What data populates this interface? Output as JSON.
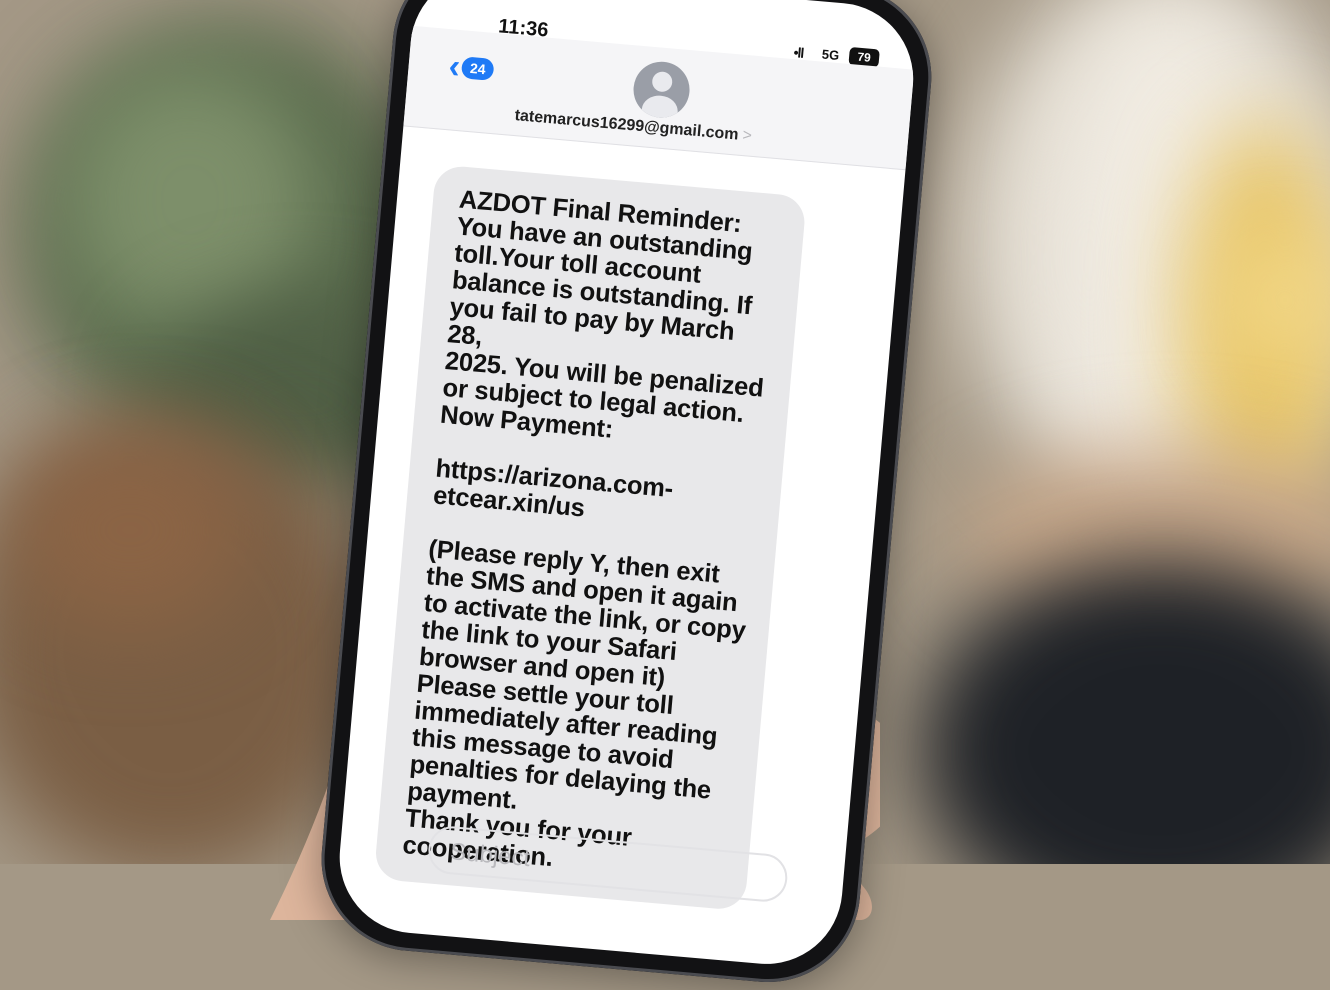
{
  "status_bar": {
    "time": "11:36",
    "signal": "•ll",
    "network": "5G",
    "battery": "79"
  },
  "header": {
    "back_badge": "24",
    "contact": "tatemarcus16299@gmail.com",
    "contact_arrow": ">"
  },
  "message": {
    "lines": [
      "AZDOT Final Reminder:",
      "You have an outstanding",
      "toll.Your toll account",
      "balance is outstanding. If",
      "you fail to pay by March 28,",
      "2025. You will be penalized",
      "or subject to legal action.",
      "Now Payment:",
      "",
      "https://arizona.com-",
      "etcear.xin/us",
      "",
      "(Please reply Y, then exit",
      "the SMS and open it again",
      "to activate the link, or copy",
      "the link to your Safari",
      "browser and open it)",
      "Please settle your toll",
      "immediately after reading",
      "this message to avoid",
      "penalties for delaying the",
      "payment.",
      "Thank you for your",
      "cooperation."
    ]
  },
  "compose": {
    "subject_placeholder": "Subject"
  },
  "colors": {
    "ios_blue": "#1f7af6",
    "bubble_gray": "#e8e8ea"
  }
}
